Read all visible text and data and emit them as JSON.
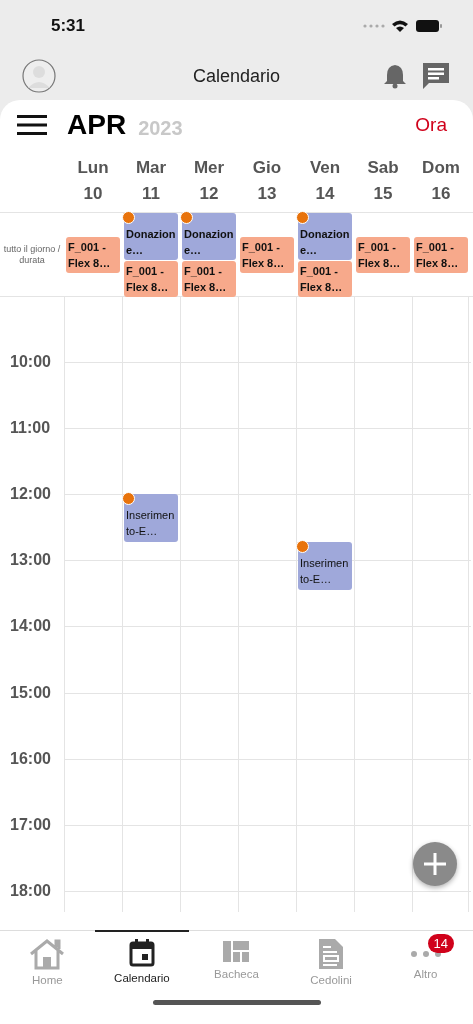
{
  "status_bar": {
    "time": "5:31"
  },
  "app_bar": {
    "title": "Calendario"
  },
  "calendar": {
    "month": "APR",
    "year": "2023",
    "today_button": "Ora",
    "all_day_label": "tutto il giorno / durata",
    "days": [
      {
        "name": "Lun",
        "number": "10",
        "all_day": [
          {
            "kind": "shift",
            "title": "F_001 - Flex 8…",
            "flagged": false
          }
        ]
      },
      {
        "name": "Mar",
        "number": "11",
        "all_day": [
          {
            "kind": "leave",
            "title": "Donazione…",
            "flagged": true
          },
          {
            "kind": "shift",
            "title": "F_001 - Flex 8…",
            "flagged": false
          }
        ],
        "events": [
          {
            "kind": "request",
            "title": "Inserimento-E…",
            "flagged": true
          }
        ]
      },
      {
        "name": "Mer",
        "number": "12",
        "all_day": [
          {
            "kind": "leave",
            "title": "Donazione…",
            "flagged": true
          },
          {
            "kind": "shift",
            "title": "F_001 - Flex 8…",
            "flagged": false
          }
        ]
      },
      {
        "name": "Gio",
        "number": "13",
        "all_day": [
          {
            "kind": "shift",
            "title": "F_001 - Flex 8…",
            "flagged": false
          }
        ]
      },
      {
        "name": "Ven",
        "number": "14",
        "all_day": [
          {
            "kind": "leave",
            "title": "Donazione…",
            "flagged": true
          },
          {
            "kind": "shift",
            "title": "F_001 - Flex 8…",
            "flagged": false
          }
        ],
        "events": [
          {
            "kind": "request",
            "title": "Inserimento-E…",
            "flagged": true
          }
        ]
      },
      {
        "name": "Sab",
        "number": "15",
        "all_day": [
          {
            "kind": "shift",
            "title": "F_001 - Flex 8…",
            "flagged": false
          }
        ]
      },
      {
        "name": "Dom",
        "number": "16",
        "all_day": [
          {
            "kind": "shift",
            "title": "F_001 - Flex 8…",
            "flagged": false
          }
        ]
      }
    ],
    "hours": [
      "10:00",
      "11:00",
      "12:00",
      "13:00",
      "14:00",
      "15:00",
      "16:00",
      "17:00",
      "18:00"
    ]
  },
  "tab_bar": [
    {
      "kind": "home",
      "label": "Home",
      "selected": false
    },
    {
      "kind": "calendar",
      "label": "Calendario",
      "selected": true
    },
    {
      "kind": "board",
      "label": "Bacheca",
      "selected": false
    },
    {
      "kind": "document",
      "label": "Cedolini",
      "selected": false
    },
    {
      "kind": "more",
      "label": "Altro",
      "selected": false,
      "badge": "14"
    }
  ]
}
